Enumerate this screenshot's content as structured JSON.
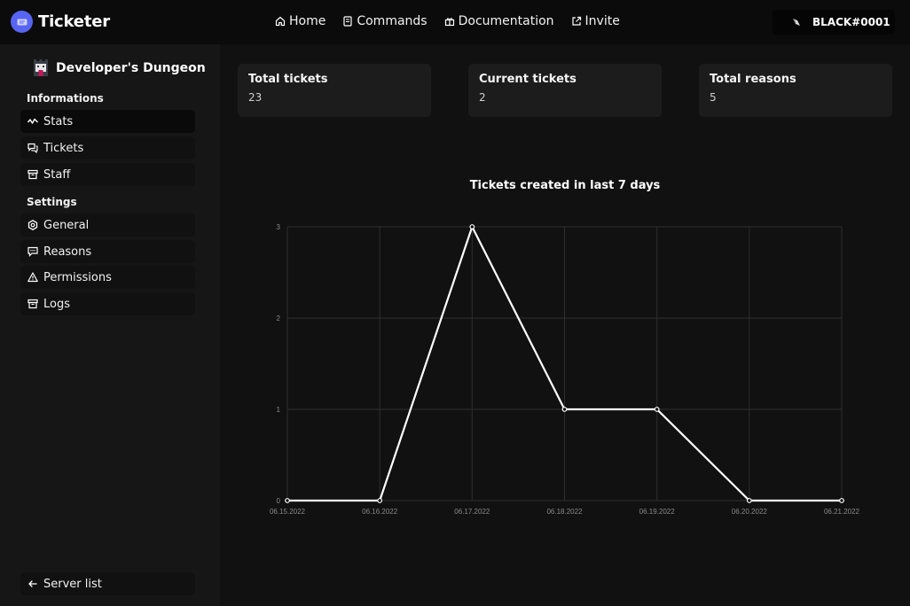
{
  "header": {
    "brand": "Ticketer",
    "nav": [
      {
        "label": "Home",
        "icon": "home-icon"
      },
      {
        "label": "Commands",
        "icon": "book-icon"
      },
      {
        "label": "Documentation",
        "icon": "gift-icon"
      },
      {
        "label": "Invite",
        "icon": "external-link-icon"
      }
    ],
    "user": "BLACK#0001"
  },
  "sidebar": {
    "guild_name": "Developer's Dungeon",
    "sections": [
      {
        "title": "Informations",
        "items": [
          {
            "label": "Stats",
            "icon": "activity-icon",
            "active": true
          },
          {
            "label": "Tickets",
            "icon": "chat-icon"
          },
          {
            "label": "Staff",
            "icon": "archive-icon"
          }
        ]
      },
      {
        "title": "Settings",
        "items": [
          {
            "label": "General",
            "icon": "gear-icon"
          },
          {
            "label": "Reasons",
            "icon": "message-icon"
          },
          {
            "label": "Permissions",
            "icon": "warning-icon"
          },
          {
            "label": "Logs",
            "icon": "archive-icon"
          }
        ]
      }
    ],
    "server_list": "Server list"
  },
  "stats": [
    {
      "title": "Total tickets",
      "value": "23"
    },
    {
      "title": "Current tickets",
      "value": "2"
    },
    {
      "title": "Total reasons",
      "value": "5"
    }
  ],
  "colors": {
    "background": "#111111",
    "sidebar": "#161616",
    "card": "#1c1c1c",
    "accent": "#5865f2",
    "line": "#ffffff"
  },
  "chart_data": {
    "type": "line",
    "title": "Tickets created in last 7 days",
    "categories": [
      "06.15.2022",
      "06.16.2022",
      "06.17.2022",
      "06.18.2022",
      "06.19.2022",
      "06.20.2022",
      "06.21.2022"
    ],
    "series": [
      {
        "values": [
          0,
          0,
          3,
          1,
          1,
          0,
          0
        ]
      }
    ],
    "yticks": [
      "0",
      "1",
      "2",
      "3"
    ],
    "ylim": [
      0,
      3
    ],
    "xlabel": "",
    "ylabel": "",
    "grid": true
  }
}
